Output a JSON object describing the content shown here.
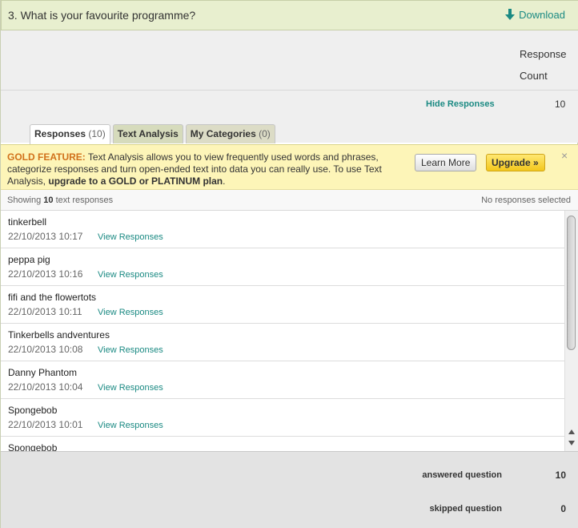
{
  "question": {
    "title": "3. What is your favourite programme?",
    "download_label": "Download",
    "download_icon": "down-arrow-icon",
    "accent_color": "#1b8a83"
  },
  "response_count": {
    "label_line1": "Response",
    "label_line2": "Count",
    "hide_label": "Hide Responses",
    "value": "10"
  },
  "tabs": [
    {
      "label": "Responses",
      "count": "(10)",
      "active": true
    },
    {
      "label": "Text Analysis",
      "count": "",
      "active": false
    },
    {
      "label": "My Categories",
      "count": "(0)",
      "active": false
    }
  ],
  "gold_banner": {
    "label": "GOLD FEATURE:",
    "text_part1": " Text Analysis allows you to view frequently used words and phrases, categorize responses and turn open-ended text into data you can really use. To use Text Analysis, ",
    "text_strong": "upgrade to a GOLD or PLATINUM plan",
    "text_end": ".",
    "learn_more": "Learn More",
    "upgrade": "Upgrade »",
    "close": "×",
    "label_color": "#d1701a"
  },
  "showing": {
    "prefix": "Showing ",
    "count": "10",
    "suffix": " text responses",
    "selection": "No responses selected"
  },
  "responses": [
    {
      "text": "tinkerbell",
      "date": "22/10/2013 10:17",
      "link": "View Responses"
    },
    {
      "text": "peppa pig",
      "date": "22/10/2013 10:16",
      "link": "View Responses"
    },
    {
      "text": "fifi and the flowertots",
      "date": "22/10/2013 10:11",
      "link": "View Responses"
    },
    {
      "text": "Tinkerbells andventures",
      "date": "22/10/2013 10:08",
      "link": "View Responses"
    },
    {
      "text": "Danny Phantom",
      "date": "22/10/2013 10:04",
      "link": "View Responses"
    },
    {
      "text": "Spongebob",
      "date": "22/10/2013 10:01",
      "link": "View Responses"
    },
    {
      "text": "Spongebob",
      "date": "",
      "link": ""
    }
  ],
  "stats": {
    "answered_label": "answered question",
    "answered_value": "10",
    "skipped_label": "skipped question",
    "skipped_value": "0"
  }
}
